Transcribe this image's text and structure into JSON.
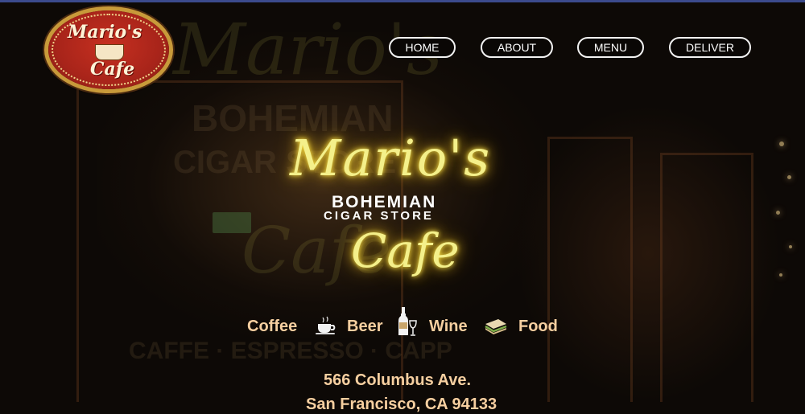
{
  "nav": {
    "items": [
      "HOME",
      "ABOUT",
      "MENU",
      "DELIVER"
    ]
  },
  "logo": {
    "line1": "Mario's",
    "line2": "Cafe"
  },
  "sign": {
    "top_script": "Mario's",
    "name_line1": "BOHEMIAN",
    "name_line2": "CIGAR STORE",
    "bottom_script": "Cafe"
  },
  "offerings": {
    "items": [
      "Coffee",
      "Beer",
      "Wine",
      "Food"
    ],
    "icons": [
      "coffee-cup-icon",
      "wine-bottle-icon",
      "sandwich-icon"
    ]
  },
  "address": {
    "street": "566 Columbus Ave.",
    "city_partial": "San Francisco, CA 94133"
  },
  "colors": {
    "neon": "#f4f08a",
    "text_accent": "#f6cfa0",
    "nav_border": "#f2f2f2",
    "logo_red": "#a8241a"
  }
}
